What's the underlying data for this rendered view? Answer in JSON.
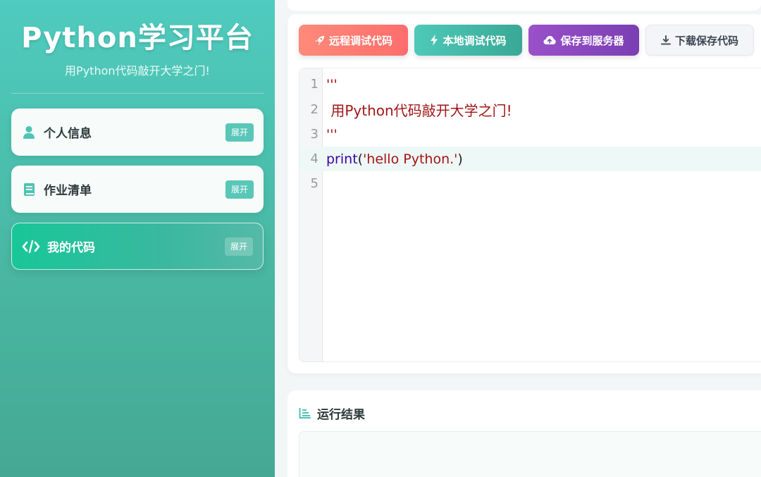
{
  "brand": {
    "title": "Python学习平台",
    "subtitle": "用Python代码敲开大学之门!"
  },
  "sidebar": {
    "items": [
      {
        "label": "个人信息",
        "icon": "user-icon",
        "badge": "展开"
      },
      {
        "label": "作业清单",
        "icon": "book-icon",
        "badge": "展开"
      },
      {
        "label": "我的代码",
        "icon": "code-icon",
        "badge": "展开",
        "active": true
      }
    ]
  },
  "toolbar": {
    "remote_label": "远程调试代码",
    "local_label": "本地调试代码",
    "save_label": "保存到服务器",
    "download_label": "下载保存代码"
  },
  "editor": {
    "line_numbers": [
      "1",
      "2",
      "3",
      "4",
      "5"
    ],
    "lines": [
      "'''",
      " 用Python代码敲开大学之门!",
      "'''",
      "",
      ""
    ],
    "line4": {
      "func": "print",
      "open": "(",
      "string": "'hello Python.'",
      "close": ")"
    }
  },
  "result": {
    "title": "运行结果",
    "icon": "list-icon",
    "output": ""
  },
  "colors": {
    "sidebar_top": "#4fcbbf",
    "sidebar_bottom": "#45a894",
    "remote_btn": "#fd6e6c",
    "local_btn": "#3aa896",
    "save_btn": "#7a3fb3",
    "accent": "#59c7b8"
  }
}
